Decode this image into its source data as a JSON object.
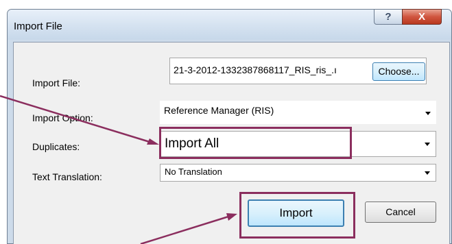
{
  "window": {
    "title": "Import File",
    "help_glyph": "?",
    "close_glyph": "X"
  },
  "form": {
    "import_file": {
      "label": "Import File:",
      "value": "21-3-2012-1332387868117_RIS_ris_.ı",
      "choose_label": "Choose..."
    },
    "import_option": {
      "label": "Import Option:",
      "value": "Reference Manager (RIS)"
    },
    "duplicates": {
      "label": "Duplicates:",
      "value": "Import All"
    },
    "text_translation": {
      "label": "Text Translation:",
      "value": "No Translation"
    }
  },
  "buttons": {
    "import": "Import",
    "cancel": "Cancel"
  },
  "colors": {
    "highlight": "#8b2e5e",
    "annotation_arrow": "#8b2e5e",
    "title_bar": "#d6e3f1",
    "close_button": "#c9452e",
    "dialog_bg": "#f0f0f0"
  },
  "icons": [
    "help-icon",
    "close-icon",
    "dropdown-arrow-icon"
  ]
}
